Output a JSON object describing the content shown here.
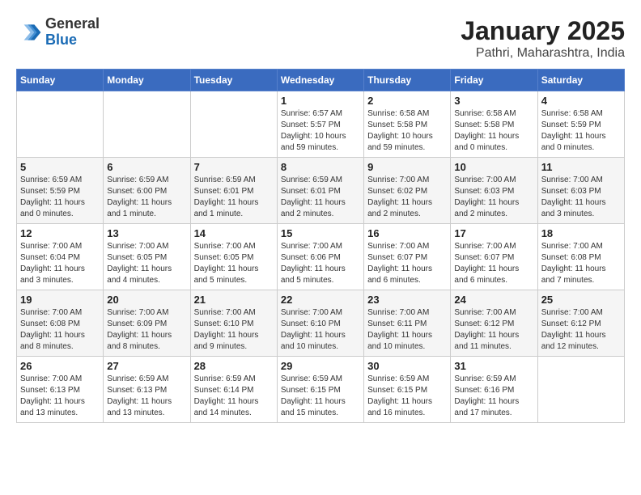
{
  "logo": {
    "general": "General",
    "blue": "Blue"
  },
  "title": "January 2025",
  "subtitle": "Pathri, Maharashtra, India",
  "days_of_week": [
    "Sunday",
    "Monday",
    "Tuesday",
    "Wednesday",
    "Thursday",
    "Friday",
    "Saturday"
  ],
  "weeks": [
    [
      {
        "day": "",
        "info": ""
      },
      {
        "day": "",
        "info": ""
      },
      {
        "day": "",
        "info": ""
      },
      {
        "day": "1",
        "info": "Sunrise: 6:57 AM\nSunset: 5:57 PM\nDaylight: 10 hours\nand 59 minutes."
      },
      {
        "day": "2",
        "info": "Sunrise: 6:58 AM\nSunset: 5:58 PM\nDaylight: 10 hours\nand 59 minutes."
      },
      {
        "day": "3",
        "info": "Sunrise: 6:58 AM\nSunset: 5:58 PM\nDaylight: 11 hours\nand 0 minutes."
      },
      {
        "day": "4",
        "info": "Sunrise: 6:58 AM\nSunset: 5:59 PM\nDaylight: 11 hours\nand 0 minutes."
      }
    ],
    [
      {
        "day": "5",
        "info": "Sunrise: 6:59 AM\nSunset: 5:59 PM\nDaylight: 11 hours\nand 0 minutes."
      },
      {
        "day": "6",
        "info": "Sunrise: 6:59 AM\nSunset: 6:00 PM\nDaylight: 11 hours\nand 1 minute."
      },
      {
        "day": "7",
        "info": "Sunrise: 6:59 AM\nSunset: 6:01 PM\nDaylight: 11 hours\nand 1 minute."
      },
      {
        "day": "8",
        "info": "Sunrise: 6:59 AM\nSunset: 6:01 PM\nDaylight: 11 hours\nand 2 minutes."
      },
      {
        "day": "9",
        "info": "Sunrise: 7:00 AM\nSunset: 6:02 PM\nDaylight: 11 hours\nand 2 minutes."
      },
      {
        "day": "10",
        "info": "Sunrise: 7:00 AM\nSunset: 6:03 PM\nDaylight: 11 hours\nand 2 minutes."
      },
      {
        "day": "11",
        "info": "Sunrise: 7:00 AM\nSunset: 6:03 PM\nDaylight: 11 hours\nand 3 minutes."
      }
    ],
    [
      {
        "day": "12",
        "info": "Sunrise: 7:00 AM\nSunset: 6:04 PM\nDaylight: 11 hours\nand 3 minutes."
      },
      {
        "day": "13",
        "info": "Sunrise: 7:00 AM\nSunset: 6:05 PM\nDaylight: 11 hours\nand 4 minutes."
      },
      {
        "day": "14",
        "info": "Sunrise: 7:00 AM\nSunset: 6:05 PM\nDaylight: 11 hours\nand 5 minutes."
      },
      {
        "day": "15",
        "info": "Sunrise: 7:00 AM\nSunset: 6:06 PM\nDaylight: 11 hours\nand 5 minutes."
      },
      {
        "day": "16",
        "info": "Sunrise: 7:00 AM\nSunset: 6:07 PM\nDaylight: 11 hours\nand 6 minutes."
      },
      {
        "day": "17",
        "info": "Sunrise: 7:00 AM\nSunset: 6:07 PM\nDaylight: 11 hours\nand 6 minutes."
      },
      {
        "day": "18",
        "info": "Sunrise: 7:00 AM\nSunset: 6:08 PM\nDaylight: 11 hours\nand 7 minutes."
      }
    ],
    [
      {
        "day": "19",
        "info": "Sunrise: 7:00 AM\nSunset: 6:08 PM\nDaylight: 11 hours\nand 8 minutes."
      },
      {
        "day": "20",
        "info": "Sunrise: 7:00 AM\nSunset: 6:09 PM\nDaylight: 11 hours\nand 8 minutes."
      },
      {
        "day": "21",
        "info": "Sunrise: 7:00 AM\nSunset: 6:10 PM\nDaylight: 11 hours\nand 9 minutes."
      },
      {
        "day": "22",
        "info": "Sunrise: 7:00 AM\nSunset: 6:10 PM\nDaylight: 11 hours\nand 10 minutes."
      },
      {
        "day": "23",
        "info": "Sunrise: 7:00 AM\nSunset: 6:11 PM\nDaylight: 11 hours\nand 10 minutes."
      },
      {
        "day": "24",
        "info": "Sunrise: 7:00 AM\nSunset: 6:12 PM\nDaylight: 11 hours\nand 11 minutes."
      },
      {
        "day": "25",
        "info": "Sunrise: 7:00 AM\nSunset: 6:12 PM\nDaylight: 11 hours\nand 12 minutes."
      }
    ],
    [
      {
        "day": "26",
        "info": "Sunrise: 7:00 AM\nSunset: 6:13 PM\nDaylight: 11 hours\nand 13 minutes."
      },
      {
        "day": "27",
        "info": "Sunrise: 6:59 AM\nSunset: 6:13 PM\nDaylight: 11 hours\nand 13 minutes."
      },
      {
        "day": "28",
        "info": "Sunrise: 6:59 AM\nSunset: 6:14 PM\nDaylight: 11 hours\nand 14 minutes."
      },
      {
        "day": "29",
        "info": "Sunrise: 6:59 AM\nSunset: 6:15 PM\nDaylight: 11 hours\nand 15 minutes."
      },
      {
        "day": "30",
        "info": "Sunrise: 6:59 AM\nSunset: 6:15 PM\nDaylight: 11 hours\nand 16 minutes."
      },
      {
        "day": "31",
        "info": "Sunrise: 6:59 AM\nSunset: 6:16 PM\nDaylight: 11 hours\nand 17 minutes."
      },
      {
        "day": "",
        "info": ""
      }
    ]
  ]
}
